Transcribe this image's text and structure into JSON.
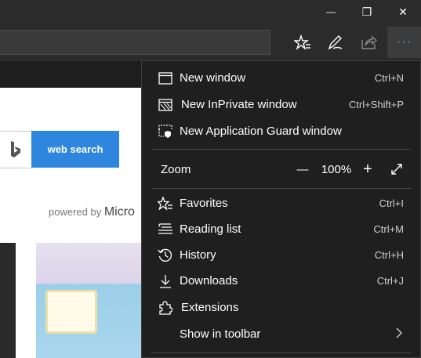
{
  "window": {
    "minimize_glyph": "—",
    "restore_glyph": "❐",
    "close_glyph": "✕"
  },
  "toolbar": {
    "more_glyph": "···"
  },
  "page": {
    "search_button": "web search",
    "powered_by": "powered by",
    "brand": "Micro"
  },
  "menu": {
    "items": [
      {
        "label": "New window",
        "shortcut": "Ctrl+N",
        "icon": "window-icon"
      },
      {
        "label": "New InPrivate window",
        "shortcut": "Ctrl+Shift+P",
        "icon": "inprivate-window-icon"
      },
      {
        "label": "New Application Guard window",
        "shortcut": "",
        "icon": "application-guard-icon"
      },
      {
        "label": "Favorites",
        "shortcut": "Ctrl+I",
        "icon": "favorites-icon"
      },
      {
        "label": "Reading list",
        "shortcut": "Ctrl+M",
        "icon": "reading-list-icon"
      },
      {
        "label": "History",
        "shortcut": "Ctrl+H",
        "icon": "history-icon"
      },
      {
        "label": "Downloads",
        "shortcut": "Ctrl+J",
        "icon": "downloads-icon"
      },
      {
        "label": "Extensions",
        "shortcut": "",
        "icon": "extensions-icon"
      },
      {
        "label": "Show in toolbar",
        "shortcut": "",
        "icon": "chevron-right-icon"
      }
    ],
    "zoom": {
      "label": "Zoom",
      "minus": "—",
      "value": "100%",
      "plus": "+"
    }
  },
  "colors": {
    "accent": "#4ba3ff",
    "search_button": "#2e86de",
    "menu_bg": "#1f1f1f",
    "chrome_bg": "#2b2b2b"
  }
}
